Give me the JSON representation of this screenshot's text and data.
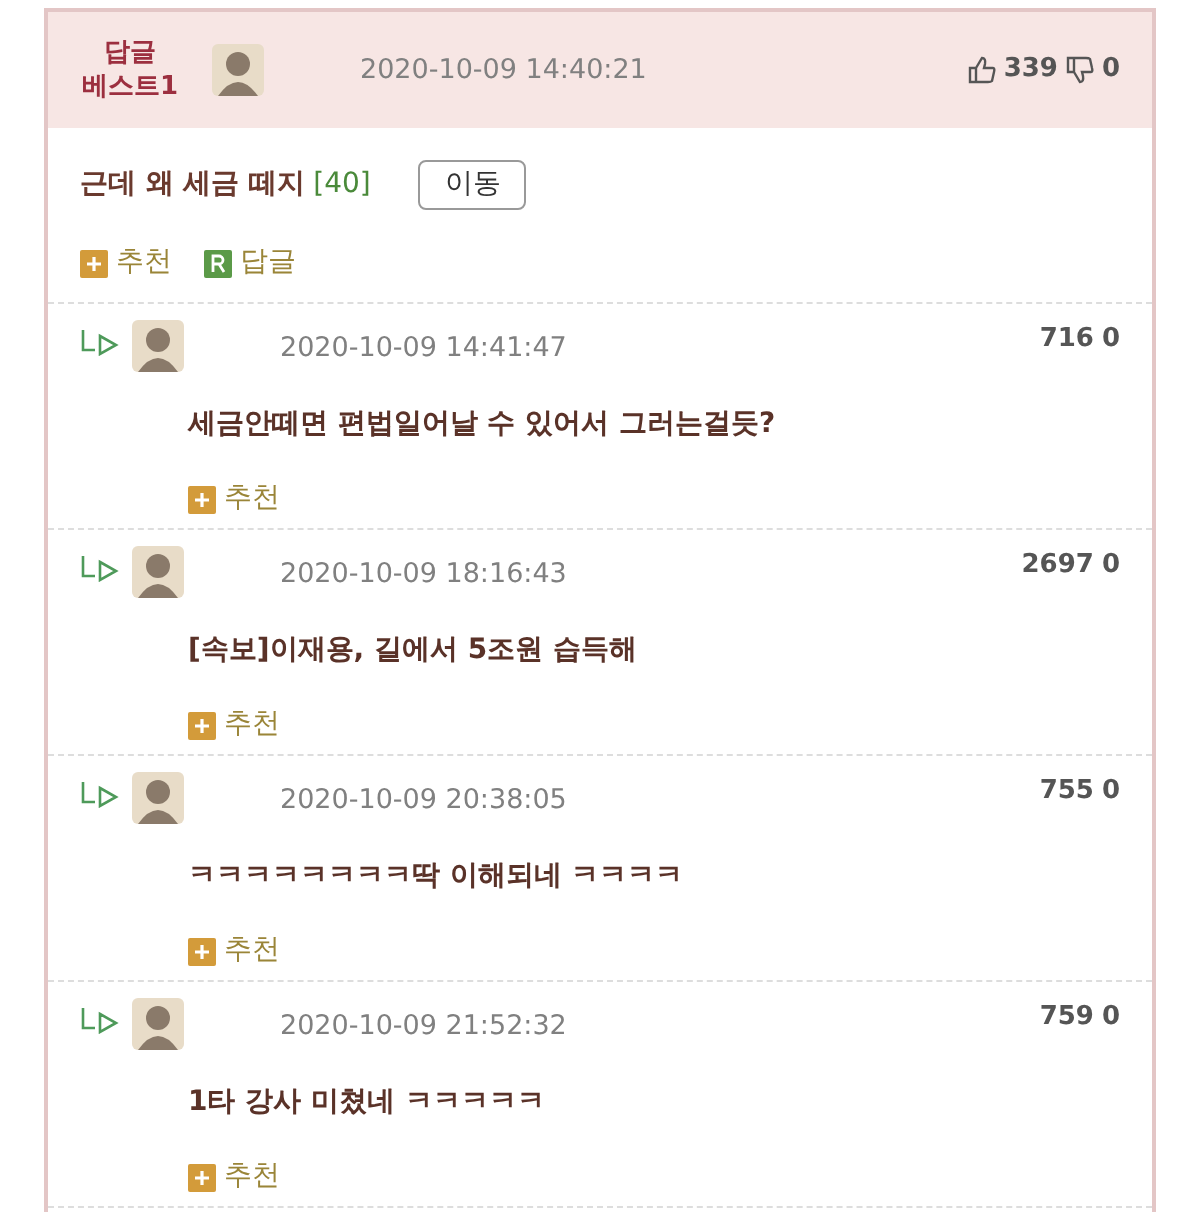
{
  "best_comment": {
    "badge_line_1": "답글",
    "badge_line_2": "베스트1",
    "date": "2020-10-09 14:40:21",
    "up_votes": "339",
    "down_votes": "0",
    "title": "근데 왜 세금 떼지",
    "count": "[40]",
    "move_button": "이동",
    "recommend": "추천",
    "reply": "답글"
  },
  "replies": [
    {
      "date": "2020-10-09 14:41:47",
      "up_votes": "716",
      "down_votes": "0",
      "text": "세금안떼면 편법일어날 수 있어서 그러는걸듯?",
      "recommend": "추천"
    },
    {
      "date": "2020-10-09 18:16:43",
      "up_votes": "2697",
      "down_votes": "0",
      "text": "[속보]이재용, 길에서 5조원 습득해",
      "recommend": "추천"
    },
    {
      "date": "2020-10-09 20:38:05",
      "up_votes": "755",
      "down_votes": "0",
      "text": "ㅋㅋㅋㅋㅋㅋㅋㅋ딱 이해되네 ㅋㅋㅋㅋ",
      "recommend": "추천"
    },
    {
      "date": "2020-10-09 21:52:32",
      "up_votes": "759",
      "down_votes": "0",
      "text": "1타 강사 미쳤네 ㅋㅋㅋㅋㅋ",
      "recommend": "추천"
    }
  ]
}
